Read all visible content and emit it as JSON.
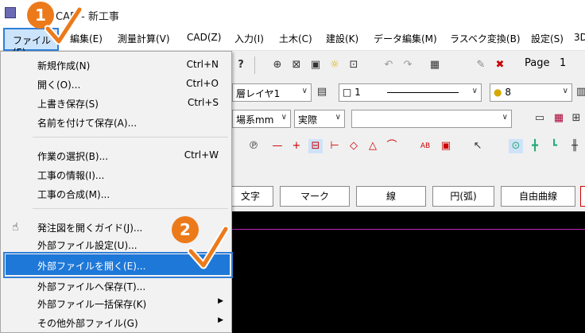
{
  "window": {
    "title": "CAD - 新工事"
  },
  "menubar": {
    "file": "ファイル(F)",
    "items": [
      "編集(E)",
      "測量計算(V)",
      "CAD(Z)",
      "入力(I)",
      "土木(C)",
      "建設(K)",
      "データ編集(M)",
      "ラスベク変換(B)",
      "設定(S)",
      "3D"
    ]
  },
  "toolbar": {
    "page_label": "Page",
    "page_value": "1",
    "layer": "層レイヤ1",
    "line_color": "1",
    "line_width": "8",
    "unit": "場系mm",
    "scale": "実際",
    "empty_combo": ""
  },
  "command_buttons": [
    "文字",
    "マーク",
    "線",
    "円(弧)",
    "自由曲線"
  ],
  "file_menu": {
    "groups": [
      [
        {
          "label": "新規作成(N)",
          "shortcut": "Ctrl+N"
        },
        {
          "label": "開く(O)...",
          "shortcut": "Ctrl+O"
        },
        {
          "label": "上書き保存(S)",
          "shortcut": "Ctrl+S"
        },
        {
          "label": "名前を付けて保存(A)...",
          "shortcut": ""
        }
      ],
      [
        {
          "label": "作業の選択(B)...",
          "shortcut": "Ctrl+W"
        },
        {
          "label": "工事の情報(I)...",
          "shortcut": ""
        },
        {
          "label": "工事の合成(M)...",
          "shortcut": ""
        }
      ],
      [
        {
          "label": "発注図を開くガイド(J)...",
          "shortcut": ""
        },
        {
          "label": "外部ファイル設定(U)...",
          "shortcut": ""
        },
        {
          "label": "外部ファイルを開く(E)...",
          "shortcut": ""
        },
        {
          "label": "外部ファイルへ保存(T)...",
          "shortcut": ""
        },
        {
          "label": "外部ファイル一括保存(K)",
          "shortcut": ""
        },
        {
          "label": "その他外部ファイル(G)",
          "shortcut": ""
        }
      ]
    ]
  },
  "steps": {
    "step1": "1",
    "step2": "2"
  },
  "colors": {
    "highlight": "#1e78d8",
    "badge": "#ec7a1b",
    "frame": "#2f7fd6",
    "canvas": "#000000",
    "canvas_line": "#c026c0"
  },
  "icons": [
    "app-icon",
    "hand-icon",
    "submenu-arrow-icon",
    "checkmark-icon"
  ]
}
